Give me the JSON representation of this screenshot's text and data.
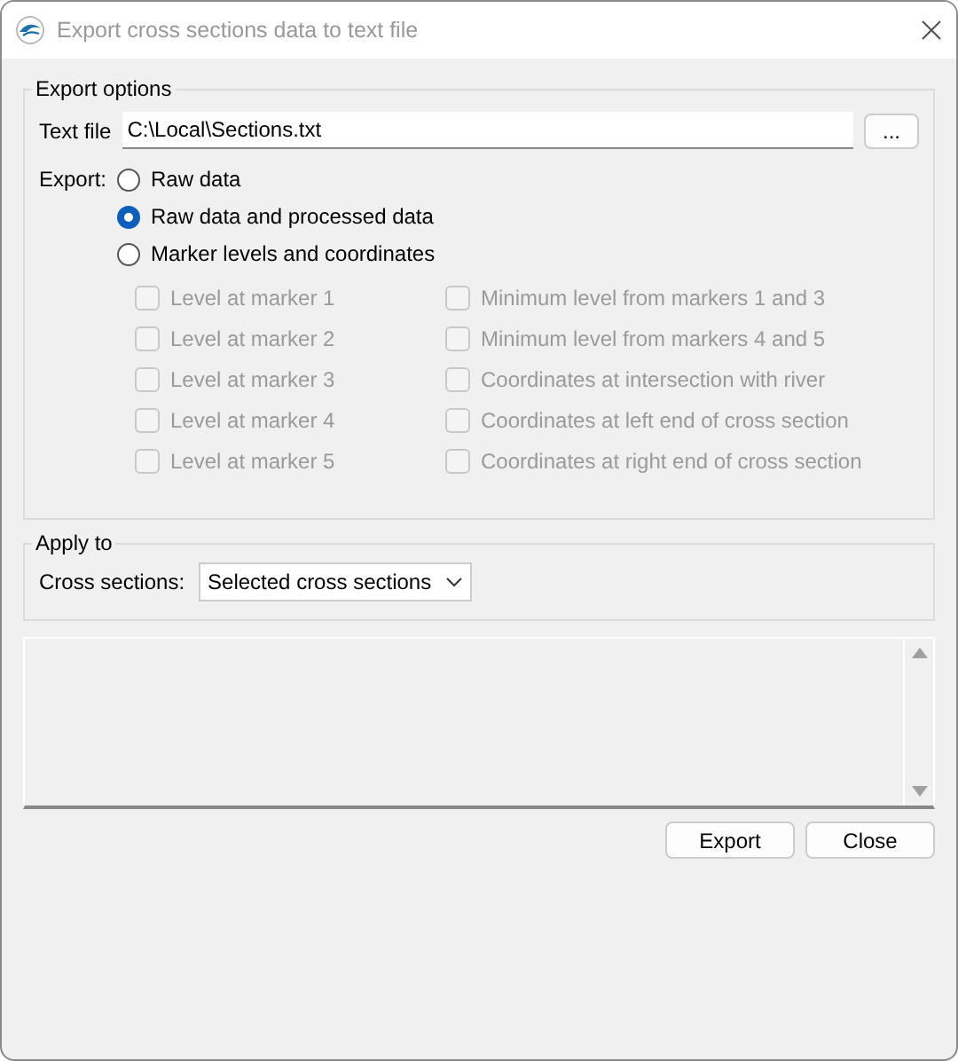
{
  "window": {
    "title": "Export cross sections data to text file"
  },
  "export_options": {
    "title": "Export options",
    "text_file": {
      "label": "Text file",
      "value": "C:\\Local\\Sections.txt",
      "browse": "..."
    },
    "export_label": "Export:",
    "modes": [
      {
        "label": "Raw data",
        "selected": false
      },
      {
        "label": "Raw data and processed data",
        "selected": true
      },
      {
        "label": "Marker levels and coordinates",
        "selected": false
      }
    ],
    "markers_left": [
      {
        "label": "Level at marker 1",
        "checked": false,
        "disabled": true
      },
      {
        "label": "Level at marker 2",
        "checked": false,
        "disabled": true
      },
      {
        "label": "Level at marker 3",
        "checked": false,
        "disabled": true
      },
      {
        "label": "Level at marker 4",
        "checked": false,
        "disabled": true
      },
      {
        "label": "Level at marker 5",
        "checked": false,
        "disabled": true
      }
    ],
    "markers_right": [
      {
        "label": "Minimum level from markers 1 and 3",
        "checked": false,
        "disabled": true
      },
      {
        "label": "Minimum level from markers 4 and 5",
        "checked": false,
        "disabled": true
      },
      {
        "label": "Coordinates at intersection with river",
        "checked": false,
        "disabled": true
      },
      {
        "label": "Coordinates at left end of cross section",
        "checked": false,
        "disabled": true
      },
      {
        "label": "Coordinates at right end of cross section",
        "checked": false,
        "disabled": true
      }
    ]
  },
  "apply_to": {
    "title": "Apply to",
    "label": "Cross sections:",
    "value": "Selected cross sections"
  },
  "buttons": [
    "Export",
    "Close"
  ]
}
